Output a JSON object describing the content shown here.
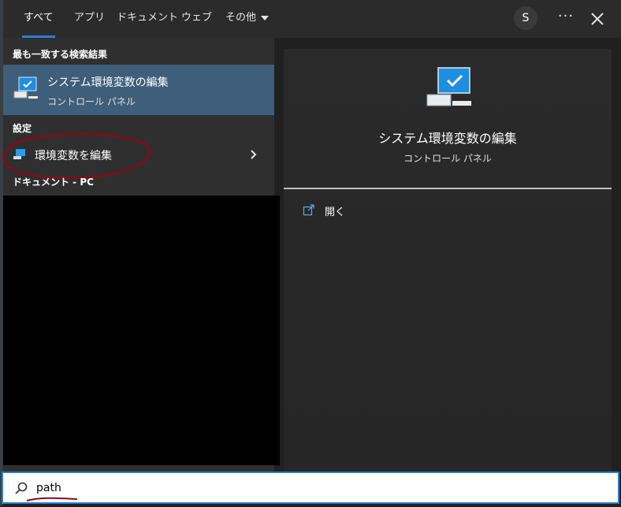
{
  "tabs": [
    {
      "label": "すべて",
      "active": true
    },
    {
      "label": "アプリ"
    },
    {
      "label": "ドキュメント"
    },
    {
      "label": "ウェブ"
    },
    {
      "label": "その他"
    }
  ],
  "user_initial": "S",
  "more_label": "···",
  "sections": {
    "best_match_header": "最も一致する検索結果",
    "settings_header": "設定",
    "documents_header": "ドキュメント - PC"
  },
  "best_match": {
    "title": "システム環境変数の編集",
    "subtitle": "コントロール パネル"
  },
  "settings_item": {
    "label": "環境変数を編集"
  },
  "preview": {
    "title": "システム環境変数の編集",
    "subtitle": "コントロール パネル",
    "action_open": "開く"
  },
  "search": {
    "value": "path"
  },
  "colors": {
    "accent": "#2d7dd2",
    "selected_bg": "#3f5e7a",
    "annotation": "#7a1020"
  }
}
